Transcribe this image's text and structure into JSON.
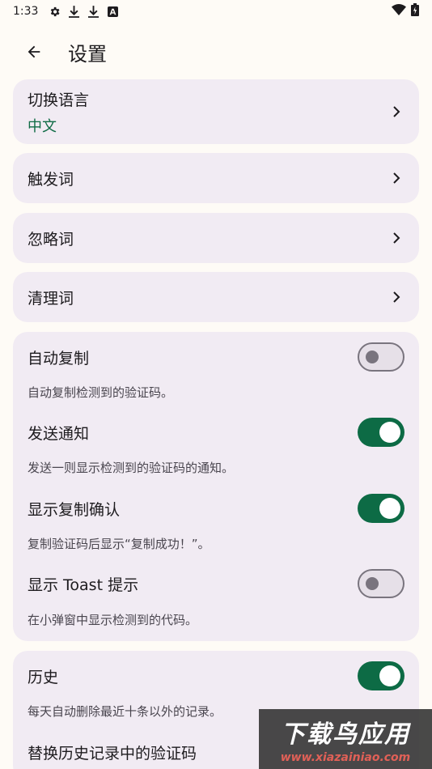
{
  "status_bar": {
    "time": "1:33",
    "icons": [
      "gear-icon",
      "download-icon",
      "download-icon",
      "a-box-icon"
    ],
    "right_icons": [
      "wifi-icon",
      "battery-icon"
    ]
  },
  "app_bar": {
    "title": "设置",
    "back_icon": "arrow-left-icon"
  },
  "nav_items": [
    {
      "label": "切换语言",
      "value": "中文"
    },
    {
      "label": "触发词"
    },
    {
      "label": "忽略词"
    },
    {
      "label": "清理词"
    }
  ],
  "toggles_group": [
    {
      "label": "自动复制",
      "description": "自动复制检测到的验证码。",
      "on": false
    },
    {
      "label": "发送通知",
      "description": "发送一则显示检测到的验证码的通知。",
      "on": true
    },
    {
      "label": "显示复制确认",
      "description": "复制验证码后显示“复制成功！”。",
      "on": true
    },
    {
      "label": "显示 Toast 提示",
      "description": "在小弹窗中显示检测到的代码。",
      "on": false
    }
  ],
  "history_group": [
    {
      "label": "历史",
      "description": "每天自动删除最近十条以外的记录。",
      "on": true
    },
    {
      "label": "替换历史记录中的验证码"
    }
  ],
  "watermark": {
    "main": "下载鸟应用",
    "sub": "www.xiazainiao.com"
  },
  "colors": {
    "accent": "#0d6b45",
    "card": "#f1ebf3",
    "background": "#fefbf6"
  }
}
